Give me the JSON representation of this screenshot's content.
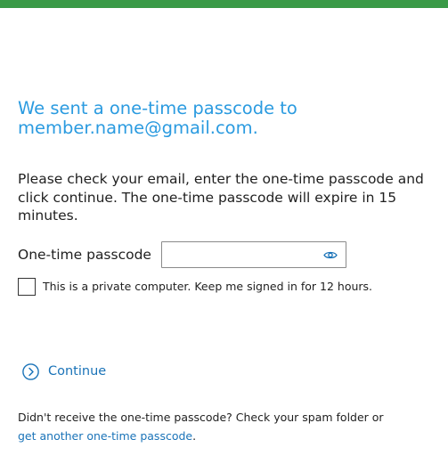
{
  "colors": {
    "top_bar": "#3a9a47",
    "heading": "#2b9be0",
    "link": "#1a73b8",
    "text": "#1f1f1f"
  },
  "heading": {
    "line1": "We sent a one-time passcode to",
    "line2": "member.name@gmail.com."
  },
  "instructions": "Please check your email, enter the one-time passcode and click continue. The one-time passcode will expire in 15 minutes.",
  "passcode": {
    "label": "One-time passcode",
    "value": "",
    "placeholder": "",
    "reveal_icon": "eye-icon"
  },
  "remember": {
    "label": "This is a private computer. Keep me signed in for 12 hours.",
    "checked": false
  },
  "continue": {
    "label": "Continue",
    "icon": "chevron-right-circle-icon"
  },
  "footer": {
    "text": "Didn't receive the one-time passcode? Check your spam folder or",
    "link_text": "get another one-time passcode",
    "suffix": "."
  }
}
